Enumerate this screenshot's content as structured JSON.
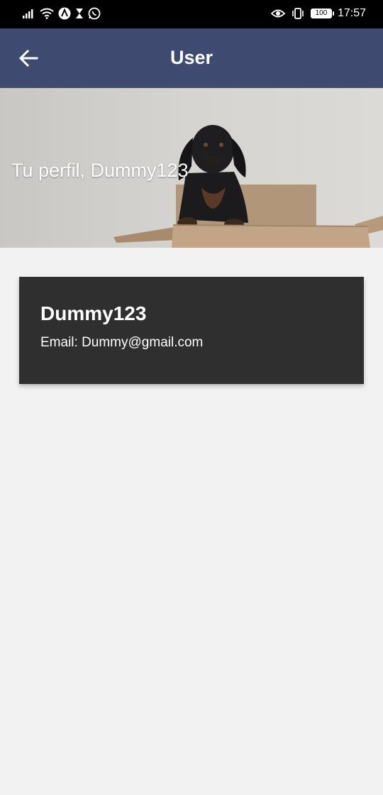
{
  "status_bar": {
    "time": "17:57",
    "battery": "100",
    "icons": [
      "signal-icon",
      "wifi-icon",
      "app-notification-icon",
      "hourglass-icon",
      "whatsapp-icon",
      "eye-icon",
      "vibrate-icon",
      "battery-icon"
    ]
  },
  "app_bar": {
    "title": "User",
    "back_icon": "arrow-left-icon"
  },
  "hero": {
    "greeting": "Tu perfil, Dummy123",
    "image": "dog-in-box-photo"
  },
  "profile_card": {
    "username": "Dummy123",
    "email": "Email: Dummy@gmail.com"
  },
  "colors": {
    "app_bar": "#3f4a70",
    "card": "#2f2f2f",
    "background": "#f2f2f2"
  }
}
